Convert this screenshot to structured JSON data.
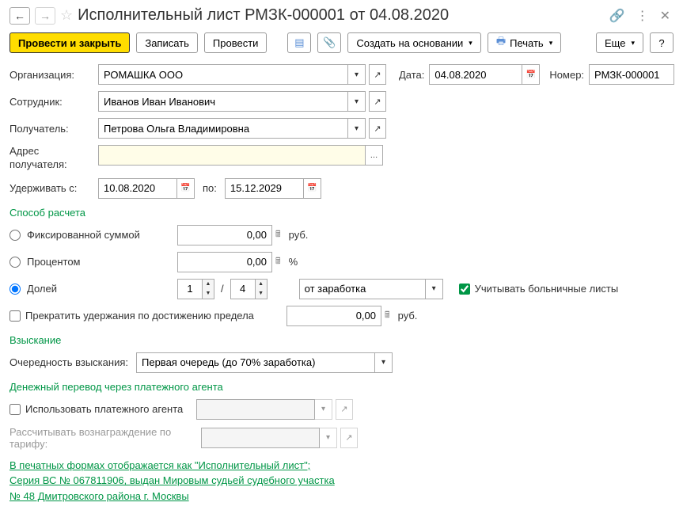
{
  "title": "Исполнительный лист РМЗК-000001 от 04.08.2020",
  "toolbar": {
    "post_close": "Провести и закрыть",
    "save": "Записать",
    "post": "Провести",
    "create_based": "Создать на основании",
    "print": "Печать",
    "more": "Еще"
  },
  "fields": {
    "org_label": "Организация:",
    "org_value": "РОМАШКА ООО",
    "date_label": "Дата:",
    "date_value": "04.08.2020",
    "number_label": "Номер:",
    "number_value": "РМЗК-000001",
    "employee_label": "Сотрудник:",
    "employee_value": "Иванов Иван Иванович",
    "recipient_label": "Получатель:",
    "recipient_value": "Петрова Ольга Владимировна",
    "address_label": "Адрес получателя:",
    "address_value": "",
    "withhold_label": "Удерживать с:",
    "withhold_from": "10.08.2020",
    "to_label": "по:",
    "withhold_to": "15.12.2029"
  },
  "calc": {
    "section": "Способ расчета",
    "fixed": "Фиксированной суммой",
    "fixed_val": "0,00",
    "rub": "руб.",
    "percent": "Процентом",
    "percent_val": "0,00",
    "pct": "%",
    "share": "Долей",
    "share_num": "1",
    "share_den": "4",
    "slash": "/",
    "base": "от заработка",
    "sick_leave": "Учитывать больничные листы",
    "stop_limit": "Прекратить удержания по достижению предела",
    "stop_val": "0,00"
  },
  "collection": {
    "section": "Взыскание",
    "order_label": "Очередность взыскания:",
    "order_value": "Первая очередь (до 70% заработка)"
  },
  "agent": {
    "section": "Денежный перевод через платежного агента",
    "use_agent": "Использовать платежного агента",
    "fee_label": "Рассчитывать вознаграждение по тарифу:"
  },
  "footer_link": "В печатных формах отображается как \"Исполнительный лист\"; Серия ВС № 067811906, выдан Мировым судьей судебного участка № 48 Дмитровского района г. Москвы"
}
